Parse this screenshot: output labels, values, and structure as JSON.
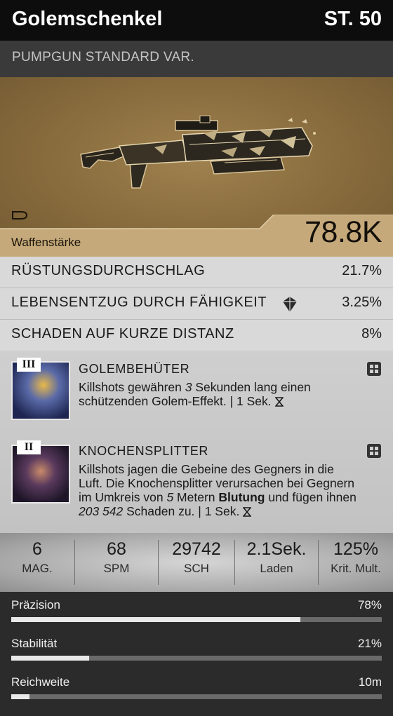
{
  "header": {
    "title": "Golemschenkel",
    "level": "ST. 50"
  },
  "subtitle": "PUMPGUN STANDARD VAR.",
  "weapon": {
    "power_label": "Waffenstärke",
    "power_value": "78.8K",
    "ammo_icon": "bullet-icon"
  },
  "perks": [
    {
      "name": "RÜSTUNGSDURCHSCHLAG",
      "value": "21.7%"
    },
    {
      "name": "LEBENSENTZUG DURCH FÄHIGKEIT",
      "value": "3.25%",
      "icon": "gem-icon"
    },
    {
      "name": "SCHADEN AUF KURZE DISTANZ",
      "value": "8%"
    }
  ],
  "mods": [
    {
      "tier": "III",
      "name": "GOLEMBEHÜTER",
      "desc": {
        "p1": "Killshots gewähren ",
        "n1": "3",
        "p2": " Sekunden lang einen schützenden Golem-Effekt. ",
        "cooldown": "| 1 Sek."
      }
    },
    {
      "tier": "II",
      "name": "KNOCHENSPLITTER",
      "desc": {
        "p1": "Killshots jagen die Gebeine des Gegners in die Luft. Die Knochensplitter verursachen bei Gegnern im Umkreis von ",
        "n1": "5",
        "p2": " Metern ",
        "bold": "Blutung",
        "p3": " und fügen ihnen ",
        "n2": "203 542",
        "p4": " Schaden zu. ",
        "cooldown": "| 1 Sek."
      }
    }
  ],
  "stats": [
    {
      "value": "6",
      "label": "MAG."
    },
    {
      "value": "68",
      "label": "SPM"
    },
    {
      "value": "29742",
      "label": "SCH"
    },
    {
      "value": "2.1Sek.",
      "label": "Laden"
    },
    {
      "value": "125%",
      "label": "Krit. Mult."
    }
  ],
  "bars": [
    {
      "label": "Präzision",
      "value": "78%",
      "fill": 0.78
    },
    {
      "label": "Stabilität",
      "value": "21%",
      "fill": 0.21
    },
    {
      "label": "Reichweite",
      "value": "10m",
      "fill": 0.05
    }
  ],
  "colors": {
    "accent_gold": "#8c6f40",
    "header_bg": "#0d0d0d",
    "bar_fill": "#e9e9e9"
  }
}
